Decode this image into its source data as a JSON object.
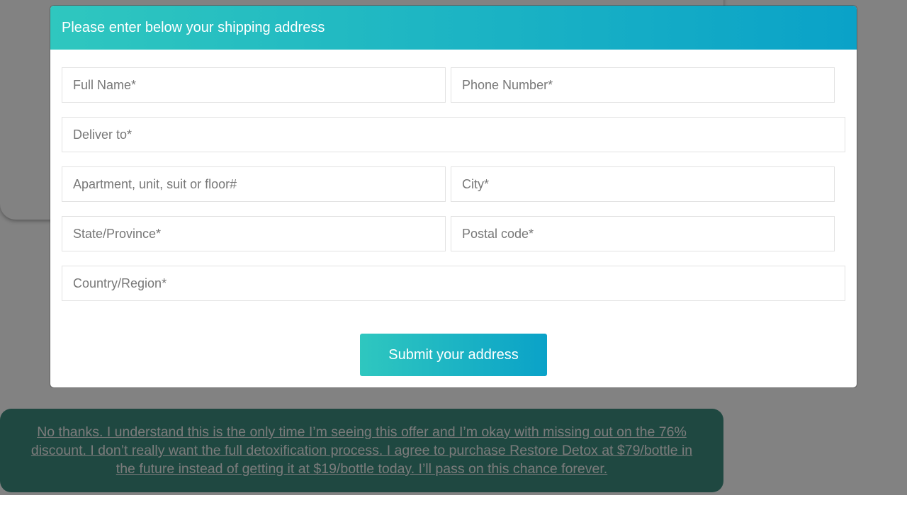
{
  "modal": {
    "title": "Please enter below your shipping address",
    "fields": {
      "full_name": {
        "placeholder": "Full Name*",
        "value": ""
      },
      "phone": {
        "placeholder": "Phone Number*",
        "value": ""
      },
      "deliver_to": {
        "placeholder": "Deliver to*",
        "value": ""
      },
      "apartment": {
        "placeholder": "Apartment, unit, suit or floor#",
        "value": ""
      },
      "city": {
        "placeholder": "City*",
        "value": ""
      },
      "state": {
        "placeholder": "State/Province*",
        "value": ""
      },
      "postal": {
        "placeholder": "Postal code*",
        "value": ""
      },
      "country": {
        "placeholder": "Country/Region*",
        "value": ""
      }
    },
    "submit_label": "Submit your address"
  },
  "background": {
    "decline_text": "No thanks. I understand this is the only time I’m seeing this offer and I’m okay with missing out on the 76% discount. I don’t really want the full detoxification process. I agree to purchase Restore Detox at $79/bottle in the future instead of getting it at $19/bottle today. I’ll pass on this chance forever."
  },
  "colors": {
    "header_gradient_start": "#2fc7bf",
    "header_gradient_end": "#0aa2c8",
    "decline_bg": "#3e8e80",
    "overlay": "rgba(0,0,0,0.49)"
  }
}
